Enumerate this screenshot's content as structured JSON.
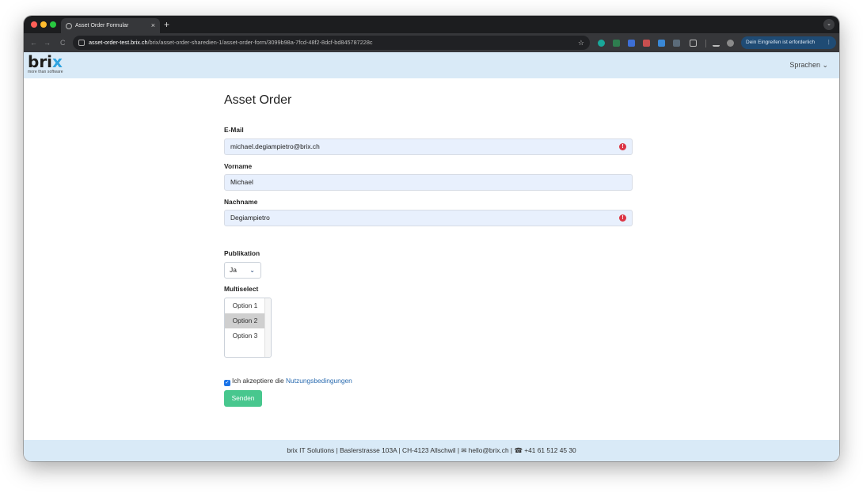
{
  "browser": {
    "tab_title": "Asset Order Formular",
    "tab_close": "×",
    "new_tab": "+",
    "url_host": "asset-order-test.brix.ch",
    "url_path": "/brix/asset-order-sharedien-1/asset-order-form/3099b98a-7fcd-48f2-8dcf-bd845787228c",
    "profile_label": "Dein Eingreifen ist erforderlich",
    "profile_menu": "⋮",
    "back": "←",
    "forward": "→",
    "reload": "C",
    "bookmark": "☆",
    "tab_menu": "⌄"
  },
  "header": {
    "logo_main": "bri",
    "logo_x": "x",
    "logo_tagline": "more than software",
    "language_button": "Sprachen ⌄"
  },
  "form": {
    "title": "Asset Order",
    "email_label": "E-Mail",
    "email_value": "michael.degiampietro@brix.ch",
    "firstname_label": "Vorname",
    "firstname_value": "Michael",
    "lastname_label": "Nachname",
    "lastname_value": "Degiampietro",
    "error_mark": "!",
    "publication_label": "Publikation",
    "publication_value": "Ja",
    "multiselect_label": "Multiselect",
    "multiselect_options": [
      "Option 1",
      "Option 2",
      "Option 3"
    ],
    "multiselect_selected": "Option 2",
    "terms_checked": true,
    "checkmark": "✓",
    "terms_text": "Ich akzeptiere die ",
    "terms_link": "Nutzungsbedingungen",
    "submit_label": "Senden"
  },
  "footer": {
    "company": "brix IT Solutions | Baslerstrasse 103A | CH-4123 Allschwil | ",
    "email_icon": "✉",
    "email": "hello@brix.ch",
    "separator": " | ",
    "phone_icon": "☎",
    "phone": "+41 61 512 45 30"
  },
  "colors": {
    "header_bg": "#d9eaf7",
    "input_bg": "#e8f0fd",
    "submit_bg": "#48c78e",
    "error_red": "#dc3545",
    "link_blue": "#2b6cb0"
  }
}
